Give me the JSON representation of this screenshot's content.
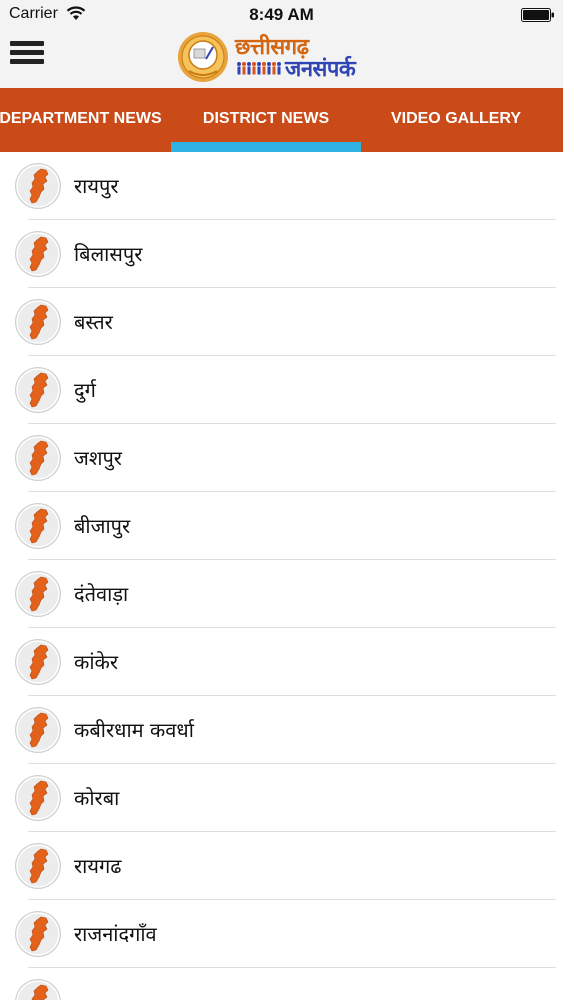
{
  "status_bar": {
    "carrier": "Carrier",
    "time": "8:49 AM"
  },
  "header": {
    "logo_title": "छत्तीसगढ़",
    "logo_subtitle": "जनसंपर्क"
  },
  "tabs": [
    {
      "label": "DEPARTMENT NEWS",
      "active": false
    },
    {
      "label": "DISTRICT NEWS",
      "active": true
    },
    {
      "label": "VIDEO GALLERY",
      "active": false
    }
  ],
  "colors": {
    "tab_bar": "#ca4a18",
    "active_indicator": "#2fb2e2",
    "map_icon": "#e2621b",
    "logo_title": "#d46612",
    "logo_subtitle": "#2f45b5"
  },
  "districts": [
    {
      "name": "रायपुर",
      "icon": "chhattisgarh-map-icon"
    },
    {
      "name": "बिलासपुर",
      "icon": "chhattisgarh-map-icon"
    },
    {
      "name": "बस्तर",
      "icon": "chhattisgarh-map-icon"
    },
    {
      "name": "दुर्ग",
      "icon": "chhattisgarh-map-icon"
    },
    {
      "name": "जशपुर",
      "icon": "chhattisgarh-map-icon"
    },
    {
      "name": "बीजापुर",
      "icon": "chhattisgarh-map-icon"
    },
    {
      "name": "दंतेवाड़ा",
      "icon": "chhattisgarh-map-icon"
    },
    {
      "name": "कांकेर",
      "icon": "chhattisgarh-map-icon"
    },
    {
      "name": "कबीरधाम कवर्धा",
      "icon": "chhattisgarh-map-icon"
    },
    {
      "name": "कोरबा",
      "icon": "chhattisgarh-map-icon"
    },
    {
      "name": "रायगढ",
      "icon": "chhattisgarh-map-icon"
    },
    {
      "name": "राजनांदगाँव",
      "icon": "chhattisgarh-map-icon"
    },
    {
      "name": "",
      "icon": "chhattisgarh-map-icon"
    }
  ]
}
